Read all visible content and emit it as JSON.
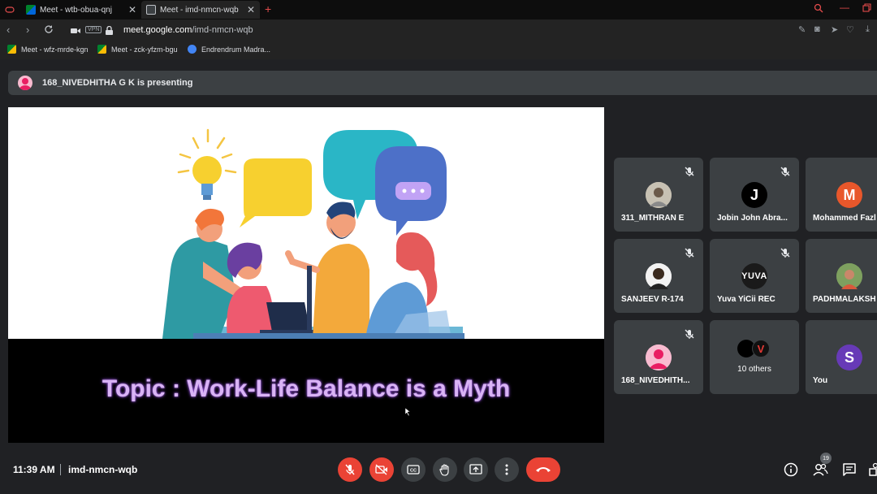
{
  "browser": {
    "tabs": [
      {
        "label": ""
      },
      {
        "label": "Meet - wtb-obua-qnj"
      },
      {
        "label": "Meet - imd-nmcn-wqb"
      }
    ],
    "new_tab": "+",
    "vpn_label": "VPN",
    "url_host": "meet.google.com",
    "url_path": "/imd-nmcn-wqb",
    "bookmarks": [
      {
        "label": "Meet - wfz-mrde-kgn"
      },
      {
        "label": "Meet - zck-yfzm-bgu"
      },
      {
        "label": "Endrendrum Madra..."
      }
    ]
  },
  "meet": {
    "presenting_text": "168_NIVEDHITHA G K is presenting",
    "slide": {
      "topic": "Topic :  Work-Life Balance is a Myth"
    },
    "participants": [
      {
        "name": "311_MITHRAN E",
        "muted": true,
        "avatar": "photo",
        "color": "#9e9e9e"
      },
      {
        "name": "Jobin John Abra...",
        "muted": true,
        "avatar": "J",
        "color": "#000000"
      },
      {
        "name": "Mohammed Fazl",
        "muted": false,
        "avatar": "M",
        "color": "#e8572b"
      },
      {
        "name": "SANJEEV R-174",
        "muted": true,
        "avatar": "photo",
        "color": "#eeeeee"
      },
      {
        "name": "Yuva YiCii REC",
        "muted": true,
        "avatar": "YUVA",
        "color": "#1a1a1a"
      },
      {
        "name": "PADHMALAKSH",
        "muted": false,
        "avatar": "photo",
        "color": "#5d8a4e"
      },
      {
        "name": "168_NIVEDHITH...",
        "muted": true,
        "avatar": "person",
        "color": "#e91e63"
      },
      {
        "name": "10 others",
        "muted": false,
        "avatar": "group",
        "color": "#000000"
      },
      {
        "name": "You",
        "muted": false,
        "avatar": "S",
        "color": "#673ab7"
      }
    ],
    "time": "11:39 AM",
    "meeting_code": "imd-nmcn-wqb",
    "people_count": "19",
    "colors": {
      "danger": "#ea4335",
      "surface": "#3c4043",
      "background": "#202124",
      "accent": "#8ab4f8"
    }
  }
}
